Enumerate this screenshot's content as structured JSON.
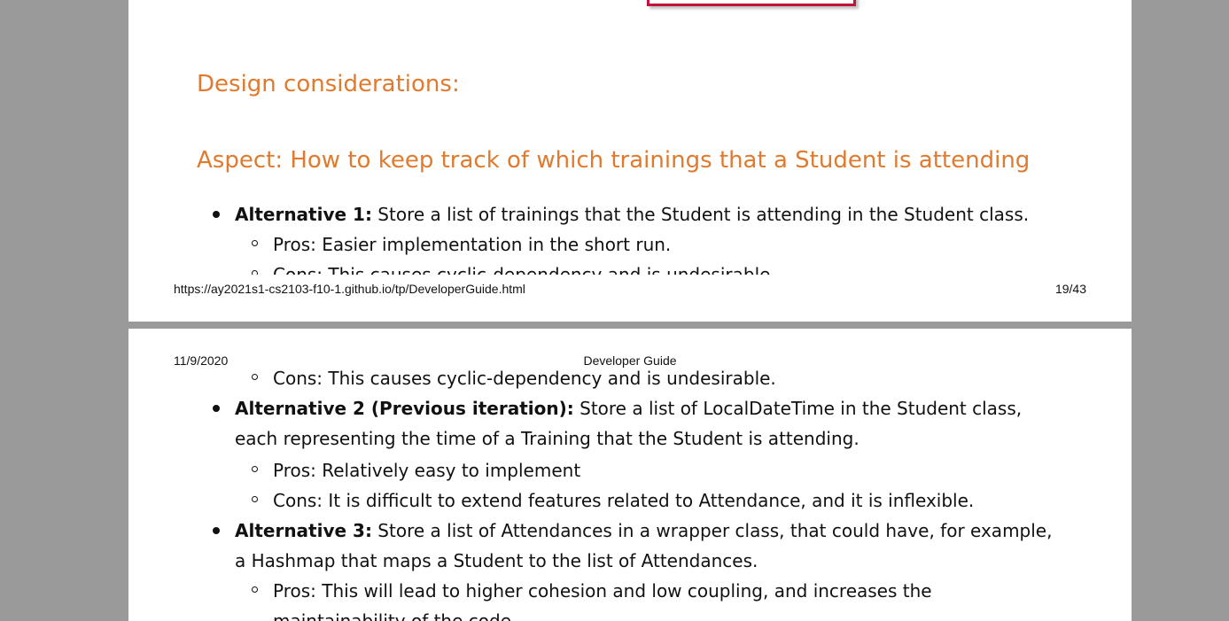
{
  "page1": {
    "design_heading": "Design considerations:",
    "aspect_heading": "Aspect: How to keep track of which trainings that a Student is attending",
    "alt1": {
      "label": "Alternative 1:",
      "text": " Store a list of trainings that the Student is attending in the Student class.",
      "pros": "Pros: Easier implementation in the short run.",
      "cons": "Cons: This causes cyclic-dependency and is undesirable."
    },
    "footer": {
      "url": "https://ay2021s1-cs2103-f10-1.github.io/tp/DeveloperGuide.html",
      "page": "19/43"
    }
  },
  "page2": {
    "header": {
      "date": "11/9/2020",
      "title": "Developer Guide"
    },
    "alt1_cons_cont": "Cons: This causes cyclic-dependency and is undesirable.",
    "alt2": {
      "label": "Alternative 2 (Previous iteration):",
      "text": " Store a list of LocalDateTime in the Student class, each representing the time of a Training that the Student is attending.",
      "pros": "Pros: Relatively easy to implement",
      "cons": "Cons: It is difficult to extend features related to Attendance, and it is inflexible."
    },
    "alt3": {
      "label": "Alternative 3:",
      "text": " Store a list of Attendances in a wrapper class, that could have, for example, a Hashmap that maps a Student to the list of Attendances.",
      "pros": "Pros: This will lead to higher cohesion and low coupling, and increases the maintainability of the code."
    }
  }
}
